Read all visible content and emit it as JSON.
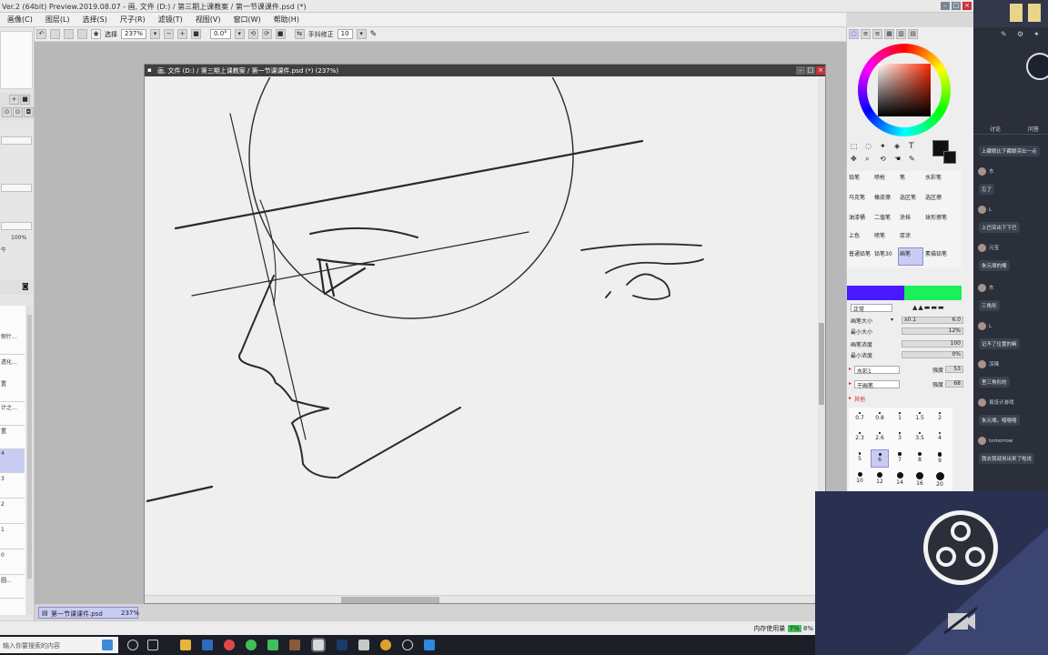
{
  "app": {
    "title": "Ver.2 (64bit) Preview.2019.08.07 - 画, 文件 (D:) / 第三期上课教案 / 第一节课课件.psd (*)",
    "menus": [
      "画像(C)",
      "图层(L)",
      "选择(S)",
      "尺子(R)",
      "滤镜(T)",
      "视图(V)",
      "窗口(W)",
      "帮助(H)"
    ]
  },
  "toolbar": {
    "select_label": "选择",
    "zoom": "237%",
    "angle": "0.0°",
    "stabilizer_label": "手抖修正",
    "stabilizer_value": "10"
  },
  "left_panel": {
    "opacity": "100%",
    "items": [
      "牛",
      "侧什...",
      "透化...",
      "置",
      "段",
      "",
      "置",
      "计之...",
      "",
      "置",
      "段",
      "4",
      "3",
      "2",
      "1",
      "0",
      "圆..."
    ]
  },
  "document": {
    "title": "画, 文件 (D:) / 第三期上课教案 / 第一节课课件.psd (*) (237%)",
    "tab_name": "第一节课课件.psd",
    "tab_zoom": "237%"
  },
  "brushes": {
    "tools": [
      "铅笔",
      "喷枪",
      "笔",
      "水彩笔",
      "马克笔",
      "橡皮擦",
      "选区笔",
      "选区擦",
      "油漆桶",
      "二值笔",
      "涂抹",
      "球形擦笔",
      "上色",
      "喷笔",
      "厚涂",
      "",
      "普通铅笔",
      "铅笔30",
      "画笔",
      "素描铅笔"
    ],
    "selected_tool": "画笔",
    "mode": "正常",
    "size_label": "画笔大小",
    "size_mult": "x0.1",
    "size_value": "6.0",
    "min_size_label": "最小大小",
    "min_size_value": "12%",
    "density_label": "画笔浓度",
    "density_value": "100",
    "min_density_label": "最小浓度",
    "min_density_value": "0%",
    "blend_label": "水彩1",
    "blend_strength_label": "强度",
    "blend_value": "53",
    "dry_label": "干画笔",
    "dry_value": "68",
    "other_label": "其他",
    "dot_sizes": [
      "0.7",
      "0.8",
      "1",
      "1.5",
      "2",
      "2.3",
      "2.6",
      "3",
      "3.5",
      "4",
      "5",
      "6",
      "7",
      "8",
      "9",
      "10",
      "12",
      "14",
      "16",
      "20"
    ],
    "selected_dot": "6"
  },
  "colors": {
    "main": "#111111",
    "bar_left": "#4a19ff",
    "bar_right": "#19f05a",
    "accent": "#c9ccf2"
  },
  "status": {
    "memory_label": "内存使用量",
    "memory_a": "7%",
    "memory_b": "8%"
  },
  "chat": {
    "tabs": [
      "讨论",
      "问答"
    ],
    "messages": [
      {
        "nick": "",
        "text": "上藏眼比下藏眼突出一点"
      },
      {
        "nick": "东",
        "text": "忘了"
      },
      {
        "nick": "L",
        "text": "上巴突出下下巴"
      },
      {
        "nick": "元宝",
        "text": "朱元璋的嘴"
      },
      {
        "nick": "东",
        "text": "三角形"
      },
      {
        "nick": "L",
        "text": "记不了位置的嘛"
      },
      {
        "nick": "凉辣",
        "text": "里三角形的"
      },
      {
        "nick": "易设计游戏",
        "text": "朱元璋。嘻嘻嘻"
      },
      {
        "nick": "tomorrow",
        "text": "我去我就用出来了啦说"
      }
    ]
  },
  "taskbar": {
    "search_placeholder": "输入你要搜索的内容"
  }
}
